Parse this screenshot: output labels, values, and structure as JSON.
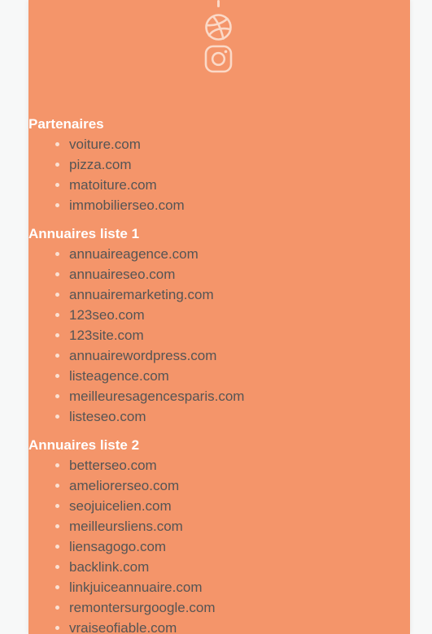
{
  "social": {
    "icons": [
      "dribbble-icon",
      "instagram-icon"
    ],
    "icon_color": "#fbd9c7"
  },
  "colors": {
    "panel_bg": "#f4956a",
    "page_bg": "#f7f8f8",
    "heading": "#ffffff",
    "link": "#555555"
  },
  "sections": [
    {
      "title": "Partenaires",
      "links": [
        "voiture.com",
        "pizza.com",
        "matoiture.com",
        "immobilierseo.com"
      ]
    },
    {
      "title": "Annuaires liste 1",
      "links": [
        "annuaireagence.com",
        "annuaireseo.com",
        "annuairemarketing.com",
        "123seo.com",
        "123site.com",
        "annuairewordpress.com",
        "listeagence.com",
        "meilleuresagencesparis.com",
        "listeseo.com"
      ]
    },
    {
      "title": "Annuaires liste 2",
      "links": [
        "betterseo.com",
        "ameliorerseo.com",
        "seojuicelien.com",
        "meilleursliens.com",
        "liensagogo.com",
        "backlink.com",
        "linkjuiceannuaire.com",
        "remontersurgoogle.com",
        "vraiseofiable.com"
      ]
    }
  ]
}
